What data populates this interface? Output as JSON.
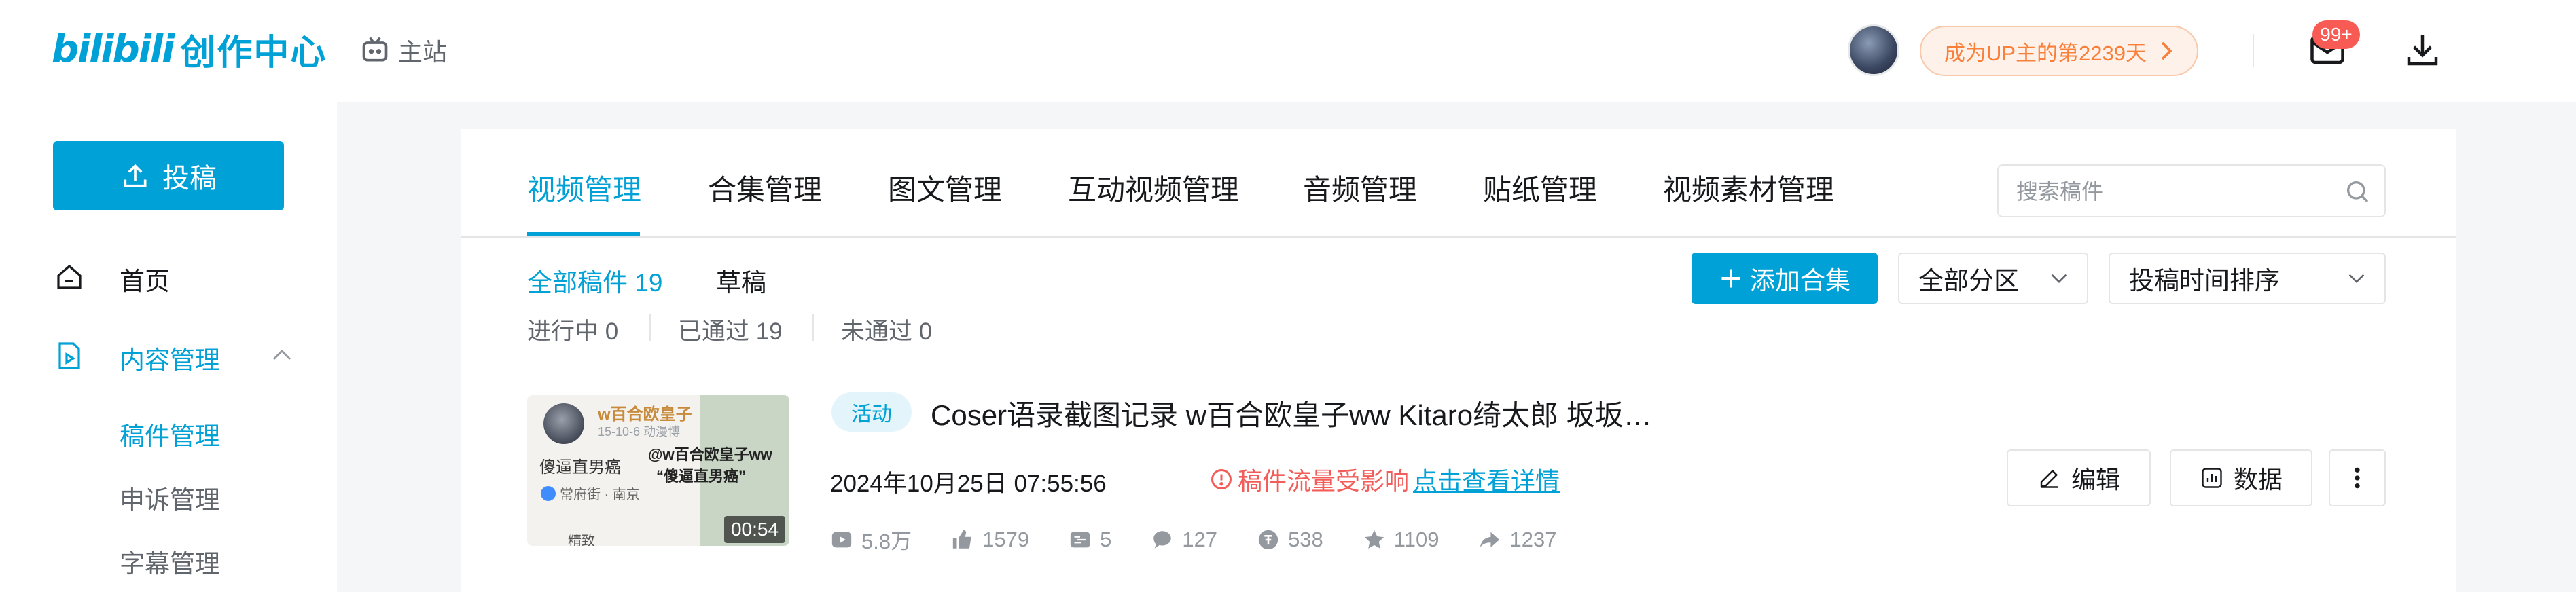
{
  "header": {
    "logo_word": "bilibili",
    "logo_cn": "创作中心",
    "home_label": "主站",
    "up_cta": "成为UP主的第2239天",
    "message_badge": "99+"
  },
  "sidebar": {
    "upload_label": "投稿",
    "home_label": "首页",
    "content_label": "内容管理",
    "sub_items": [
      "稿件管理",
      "申诉管理",
      "字幕管理"
    ]
  },
  "tabs": [
    "视频管理",
    "合集管理",
    "图文管理",
    "互动视频管理",
    "音频管理",
    "贴纸管理",
    "视频素材管理"
  ],
  "active_tab": "视频管理",
  "search": {
    "placeholder": "搜索稿件"
  },
  "filters": {
    "all_label": "全部稿件 19",
    "draft_label": "草稿",
    "status": [
      "进行中 0",
      "已通过 19",
      "未通过 0"
    ],
    "add_collection": "添加合集",
    "category_select": "全部分区",
    "sort_select": "投稿时间排序"
  },
  "video": {
    "tag": "活动",
    "title": "Coser语录截图记录 w百合欧皇子ww Kitaro绮太郎 坂坂…",
    "date": "2024年10月25日 07:55:56",
    "warn_text": "稿件流量受影响",
    "warn_link": "点击查看详情",
    "duration": "00:54",
    "thumb_texts": {
      "name": "w百合欧皇子",
      "sub": "15-10-6  动漫博",
      "line1": "傻逼直男癌",
      "line2": "@w百合欧皇子ww",
      "line3": "“傻逼直男癌”",
      "loc": "常府街 · 南京",
      "edit": "精致"
    },
    "stats": {
      "views": "5.8万",
      "likes": "1579",
      "danmaku": "5",
      "comments": "127",
      "coins": "538",
      "favorites": "1109",
      "shares": "1237"
    },
    "edit_label": "编辑",
    "data_label": "数据"
  },
  "colors": {
    "accent": "#00a1d6",
    "warn": "#f25d59",
    "up_pill": "#fa7f39",
    "badge": "#f85a54"
  }
}
